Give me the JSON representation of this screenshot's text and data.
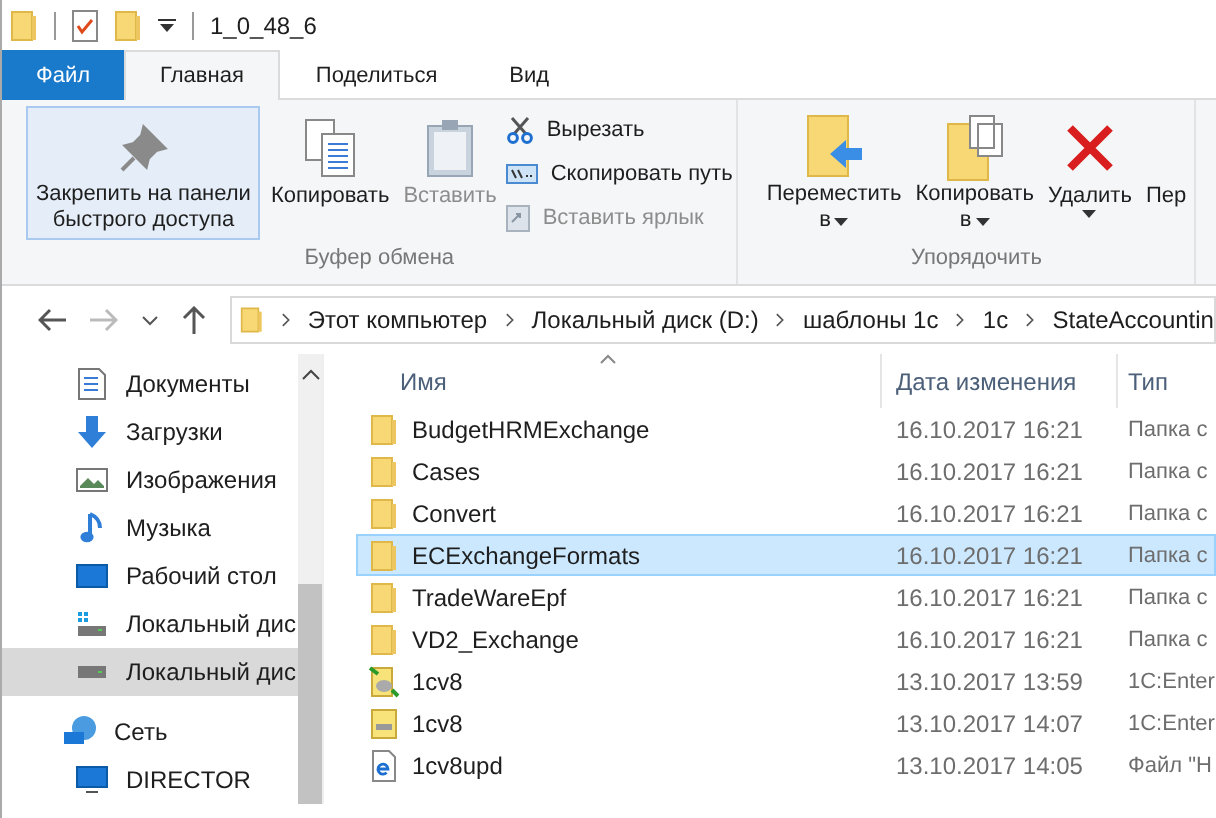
{
  "window": {
    "title": "1_0_48_6"
  },
  "tabs": [
    {
      "label": "Файл",
      "kind": "file",
      "selected": false
    },
    {
      "label": "Главная",
      "kind": "tab",
      "selected": true
    },
    {
      "label": "Поделиться",
      "kind": "tab",
      "selected": false
    },
    {
      "label": "Вид",
      "kind": "tab",
      "selected": false
    }
  ],
  "ribbon": {
    "groups": [
      {
        "label": "Буфер обмена",
        "items": [
          {
            "kind": "large",
            "lines": [
              "Закрепить на панели",
              "быстрого доступа"
            ],
            "highlighted": true,
            "disabled": false
          },
          {
            "kind": "large",
            "lines": [
              "Копировать"
            ],
            "highlighted": false,
            "disabled": false
          },
          {
            "kind": "large",
            "lines": [
              "Вставить"
            ],
            "highlighted": false,
            "disabled": true
          },
          {
            "kind": "small",
            "items": [
              {
                "label": "Вырезать",
                "disabled": false
              },
              {
                "label": "Скопировать путь",
                "disabled": false
              },
              {
                "label": "Вставить ярлык",
                "disabled": true
              }
            ]
          }
        ]
      },
      {
        "label": "Упорядочить",
        "items": [
          {
            "kind": "large",
            "lines": [
              "Переместить",
              "в"
            ],
            "dropdown": true,
            "highlighted": false,
            "disabled": false
          },
          {
            "kind": "large",
            "lines": [
              "Копировать",
              "в"
            ],
            "dropdown": true,
            "highlighted": false,
            "disabled": false
          },
          {
            "kind": "large",
            "lines": [
              "Удалить"
            ],
            "dropdown": true,
            "highlighted": false,
            "disabled": false
          },
          {
            "kind": "large",
            "lines": [
              "Пер"
            ],
            "highlighted": false,
            "disabled": false
          }
        ]
      }
    ]
  },
  "address": {
    "path": [
      "Этот компьютер",
      "Локальный диск (D:)",
      "шаблоны 1с",
      "1с",
      "StateAccountin"
    ]
  },
  "sidebar": {
    "items": [
      {
        "label": "Документы",
        "kind": "documents",
        "selected": false
      },
      {
        "label": "Загрузки",
        "kind": "downloads",
        "selected": false
      },
      {
        "label": "Изображения",
        "kind": "pictures",
        "selected": false
      },
      {
        "label": "Музыка",
        "kind": "music",
        "selected": false
      },
      {
        "label": "Рабочий стол",
        "kind": "desktop",
        "selected": false
      },
      {
        "label": "Локальный дис",
        "kind": "drivewin",
        "selected": false
      },
      {
        "label": "Локальный дис",
        "kind": "drive",
        "selected": true
      },
      {
        "label": "Сеть",
        "kind": "network",
        "selected": false,
        "children": [
          {
            "label": "DIRECTOR",
            "kind": "computer",
            "selected": false
          }
        ]
      }
    ]
  },
  "table": {
    "columns": [
      "Имя",
      "Дата изменения",
      "Тип"
    ],
    "rows": [
      {
        "name": "BudgetHRMExchange",
        "date": "16.10.2017 16:21",
        "type": "Папка с",
        "kind": "folder",
        "selected": false
      },
      {
        "name": "Cases",
        "date": "16.10.2017 16:21",
        "type": "Папка с",
        "kind": "folder",
        "selected": false
      },
      {
        "name": "Convert",
        "date": "16.10.2017 16:21",
        "type": "Папка с",
        "kind": "folder",
        "selected": false
      },
      {
        "name": "ECExchangeFormats",
        "date": "16.10.2017 16:21",
        "type": "Папка с",
        "kind": "folder",
        "selected": true
      },
      {
        "name": "TradeWareEpf",
        "date": "16.10.2017 16:21",
        "type": "Папка с",
        "kind": "folder",
        "selected": false
      },
      {
        "name": "VD2_Exchange",
        "date": "16.10.2017 16:21",
        "type": "Папка с",
        "kind": "folder",
        "selected": false
      },
      {
        "name": "1cv8",
        "date": "13.10.2017 13:59",
        "type": "1C:Enter",
        "kind": "config",
        "selected": false
      },
      {
        "name": "1cv8",
        "date": "13.10.2017 14:07",
        "type": "1C:Enter",
        "kind": "file",
        "selected": false
      },
      {
        "name": "1cv8upd",
        "date": "13.10.2017 14:05",
        "type": "Файл \"H",
        "kind": "html",
        "selected": false
      }
    ]
  }
}
